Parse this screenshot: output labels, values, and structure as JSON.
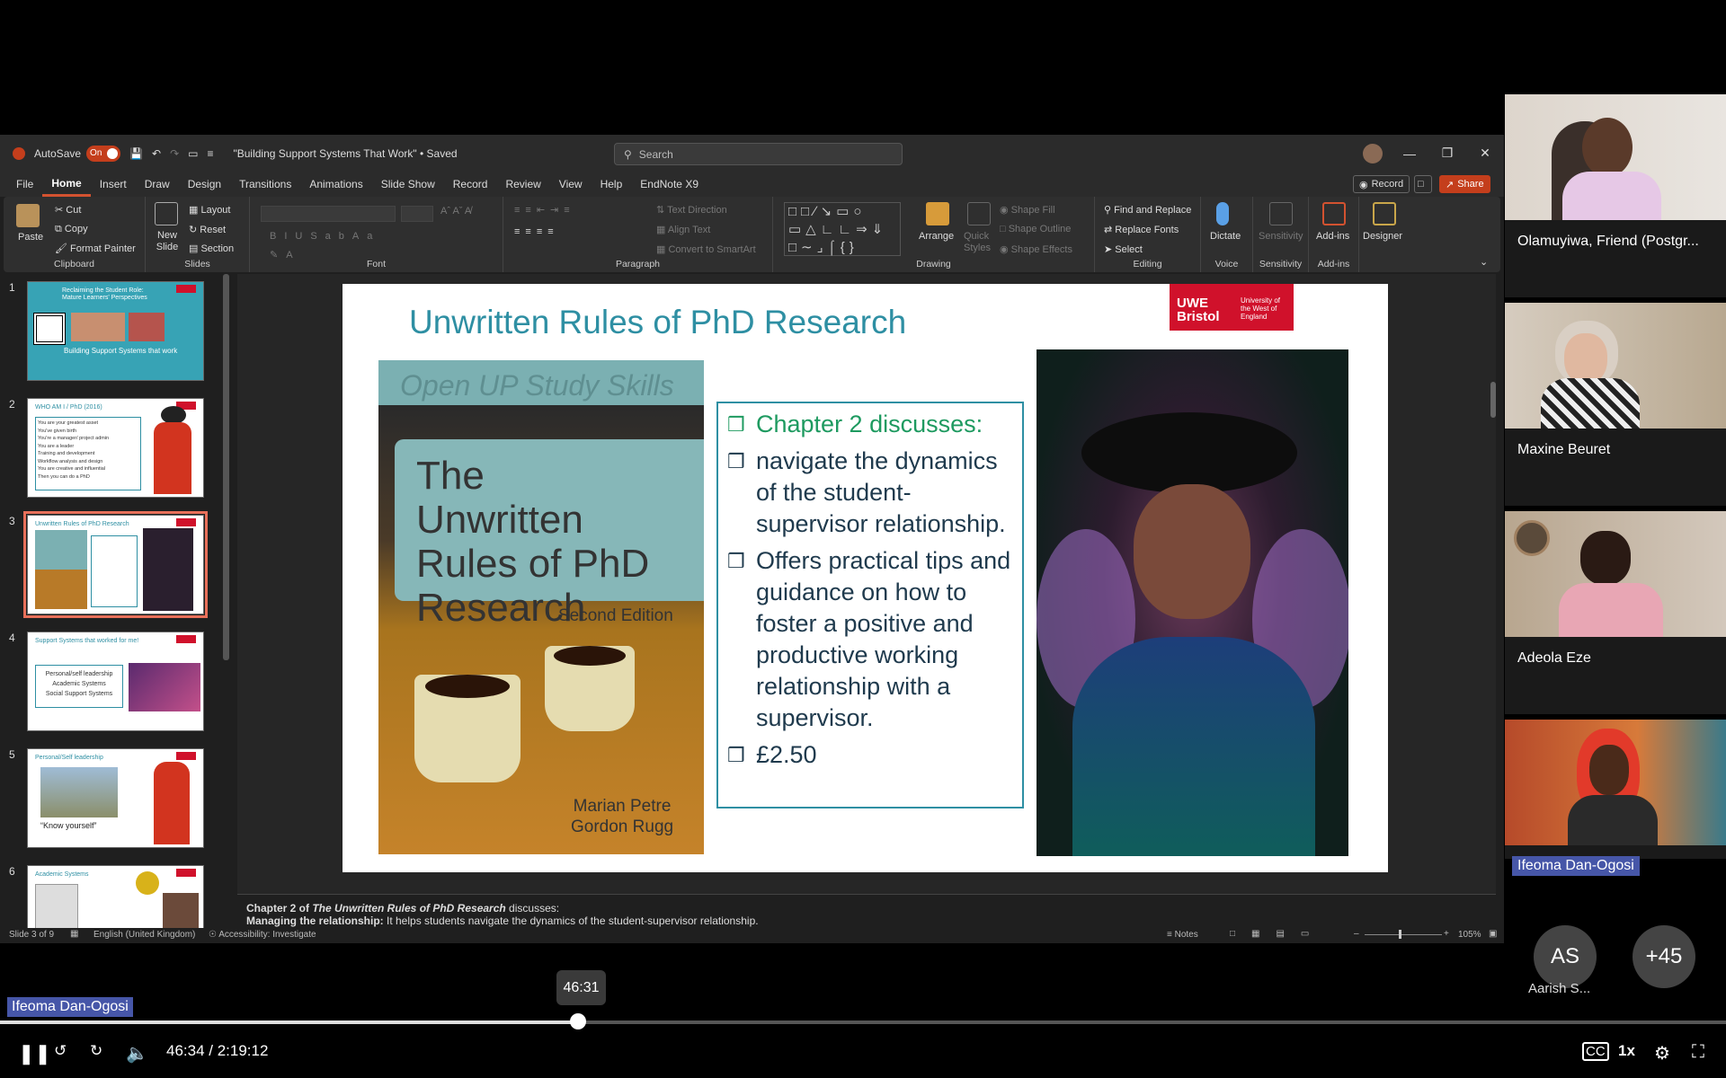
{
  "ppt": {
    "autosave_label": "AutoSave",
    "autosave_state": "On",
    "doc_title": "\"Building Support Systems That Work\" • Saved",
    "search_placeholder": "Search",
    "tabs": [
      "File",
      "Home",
      "Insert",
      "Draw",
      "Design",
      "Transitions",
      "Animations",
      "Slide Show",
      "Record",
      "Review",
      "View",
      "Help",
      "EndNote X9"
    ],
    "record_btn": "Record",
    "share_btn": "Share",
    "ribbon": {
      "clipboard": {
        "paste": "Paste",
        "cut": "Cut",
        "copy": "Copy",
        "format_painter": "Format Painter",
        "label": "Clipboard"
      },
      "slides": {
        "new_slide": "New Slide",
        "layout": "Layout",
        "reset": "Reset",
        "section": "Section",
        "label": "Slides"
      },
      "font": {
        "label": "Font"
      },
      "paragraph": {
        "text_direction": "Text Direction",
        "align_text": "Align Text",
        "convert": "Convert to SmartArt",
        "label": "Paragraph"
      },
      "drawing": {
        "arrange": "Arrange",
        "quick_styles": "Quick Styles",
        "shape_fill": "Shape Fill",
        "shape_outline": "Shape Outline",
        "shape_effects": "Shape Effects",
        "label": "Drawing"
      },
      "editing": {
        "find": "Find and Replace",
        "replace_fonts": "Replace Fonts",
        "select": "Select",
        "label": "Editing"
      },
      "voice": {
        "dictate": "Dictate",
        "label": "Voice"
      },
      "sensitivity": {
        "btn": "Sensitivity",
        "label": "Sensitivity"
      },
      "addins": {
        "btn": "Add-ins",
        "label": "Add-ins"
      },
      "designer": {
        "btn": "Designer"
      }
    },
    "thumbnails": [
      {
        "num": "1",
        "title": "Reclaiming the Student Role: Mature Learners' Perspectives",
        "subtitle": "Building Support Systems that work"
      },
      {
        "num": "2",
        "title": "WHO AM I / PhD (2016)",
        "lines": [
          "You are your greatest asset",
          "You've given birth",
          "You're a manager/ project admin",
          "You are a leader",
          "Training and development",
          "Workflow analysis and design",
          "You are creative and influential",
          "Then you can do a PhD"
        ]
      },
      {
        "num": "3",
        "title": "Unwritten Rules of PhD Research"
      },
      {
        "num": "4",
        "title": "Support Systems that worked for me!",
        "lines": [
          "Personal/self leadership",
          "Academic Systems",
          "Social Support Systems"
        ]
      },
      {
        "num": "5",
        "title": "Personal/Self leadership",
        "quote": "“Know yourself”"
      },
      {
        "num": "6",
        "title": "Academic Systems"
      }
    ],
    "slide": {
      "title": "Unwritten Rules of PhD Research",
      "logo_main": "UWE Bristol",
      "logo_sub": "University of the West of England",
      "book_series": "Open UP Study Skills",
      "book_title": "The Unwritten Rules of PhD Research",
      "book_edition": "Second Edition",
      "book_author1": "Marian Petre",
      "book_author2": "Gordon Rugg",
      "bullets": [
        "Chapter 2 discusses:",
        "navigate the dynamics of the student-supervisor relationship.",
        "Offers practical tips and guidance on how to foster a positive and productive working relationship with a supervisor.",
        "£2.50"
      ]
    },
    "notes_line1_pre": "Chapter 2 of ",
    "notes_line1_title": "The Unwritten Rules of PhD Research",
    "notes_line1_post": " discusses:",
    "notes_line2_bold": "Managing the relationship:",
    "notes_line2_rest": " It helps students navigate the dynamics of the student-supervisor relationship.",
    "status": {
      "slide": "Slide 3 of 9",
      "language": "English (United Kingdom)",
      "accessibility": "Accessibility: Investigate",
      "notes": "Notes",
      "zoom": "105%"
    }
  },
  "participants": [
    {
      "name": "Olamuyiwa, Friend (Postgr..."
    },
    {
      "name": "Maxine Beuret"
    },
    {
      "name": "Adeola Eze"
    },
    {
      "name": "Ifeoma Dan-Ogosi"
    }
  ],
  "extra": {
    "avatar_initials": "AS",
    "avatar_name": "Aarish S...",
    "more_count": "+45"
  },
  "player": {
    "speaker": "Ifeoma Dan-Ogosi",
    "hover_time": "46:31",
    "time": "46:34 / 2:19:12",
    "progress": 0.335,
    "speed": "1x"
  }
}
